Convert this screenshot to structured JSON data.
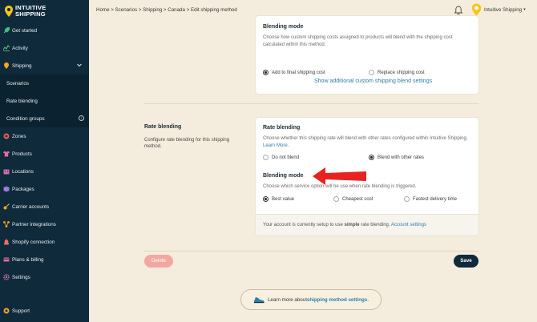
{
  "brand": {
    "line1": "INTUITIVE",
    "line2": "SHIPPING"
  },
  "sidebar": {
    "items": [
      {
        "label": "Get started",
        "icon": "rocket-icon"
      },
      {
        "label": "Activity",
        "icon": "activity-icon"
      },
      {
        "label": "Shipping",
        "icon": "pin-icon"
      },
      {
        "label": "Scenarios"
      },
      {
        "label": "Rate blending"
      },
      {
        "label": "Condition groups"
      },
      {
        "label": "Zones",
        "icon": "zones-icon"
      },
      {
        "label": "Products",
        "icon": "shirt-icon"
      },
      {
        "label": "Locations",
        "icon": "building-icon"
      },
      {
        "label": "Packages",
        "icon": "box-icon"
      },
      {
        "label": "Carrier accounts",
        "icon": "key-icon"
      },
      {
        "label": "Partner integrations",
        "icon": "integrations-icon"
      },
      {
        "label": "Shopify connection",
        "icon": "shopify-icon"
      },
      {
        "label": "Plans & billing",
        "icon": "billing-icon"
      },
      {
        "label": "Settings",
        "icon": "gear-icon"
      }
    ],
    "support": "Support"
  },
  "header": {
    "breadcrumb": "Home > Scenarios > Shipping > Canada > Edit shipping method",
    "user": "Intuitive Shipping"
  },
  "top_card": {
    "title": "Blending mode",
    "desc": "Choose how custom shipping costs assigned to products will blend with the shipping cost calculated within this method.",
    "opt1": "Add to final shipping cost",
    "opt2": "Replace shipping cost",
    "link": "Show additional custom shipping blend settings"
  },
  "rate_section": {
    "label": "Rate blending",
    "desc": "Configure rate blending for this shipping method."
  },
  "rate_card": {
    "title": "Rate blending",
    "desc": "Choose whether this shipping rate will blend with other rates configured within Intuitive Shipping.",
    "learn_more": "Learn More.",
    "opt1": "Do not blend",
    "opt2": "Blend with other rates",
    "mode_title": "Blending mode",
    "mode_desc": "Choose which service option will be use when rate blending is triggered.",
    "mode_opt1": "Best value",
    "mode_opt2": "Cheapest cost",
    "mode_opt3": "Fastest delivery time",
    "footer_pre": "Your account is currently setup to use ",
    "footer_bold": "simple",
    "footer_post": " rate blending.",
    "footer_link": "Account settings"
  },
  "actions": {
    "delete": "Delete",
    "save": "Save"
  },
  "learn": {
    "pre": "Learn more about ",
    "link": "shipping method settings",
    "post": "."
  },
  "colors": {
    "sidebar": "#0e2a3b",
    "accent": "#2f7fa8",
    "arrow": "#e8231f"
  }
}
